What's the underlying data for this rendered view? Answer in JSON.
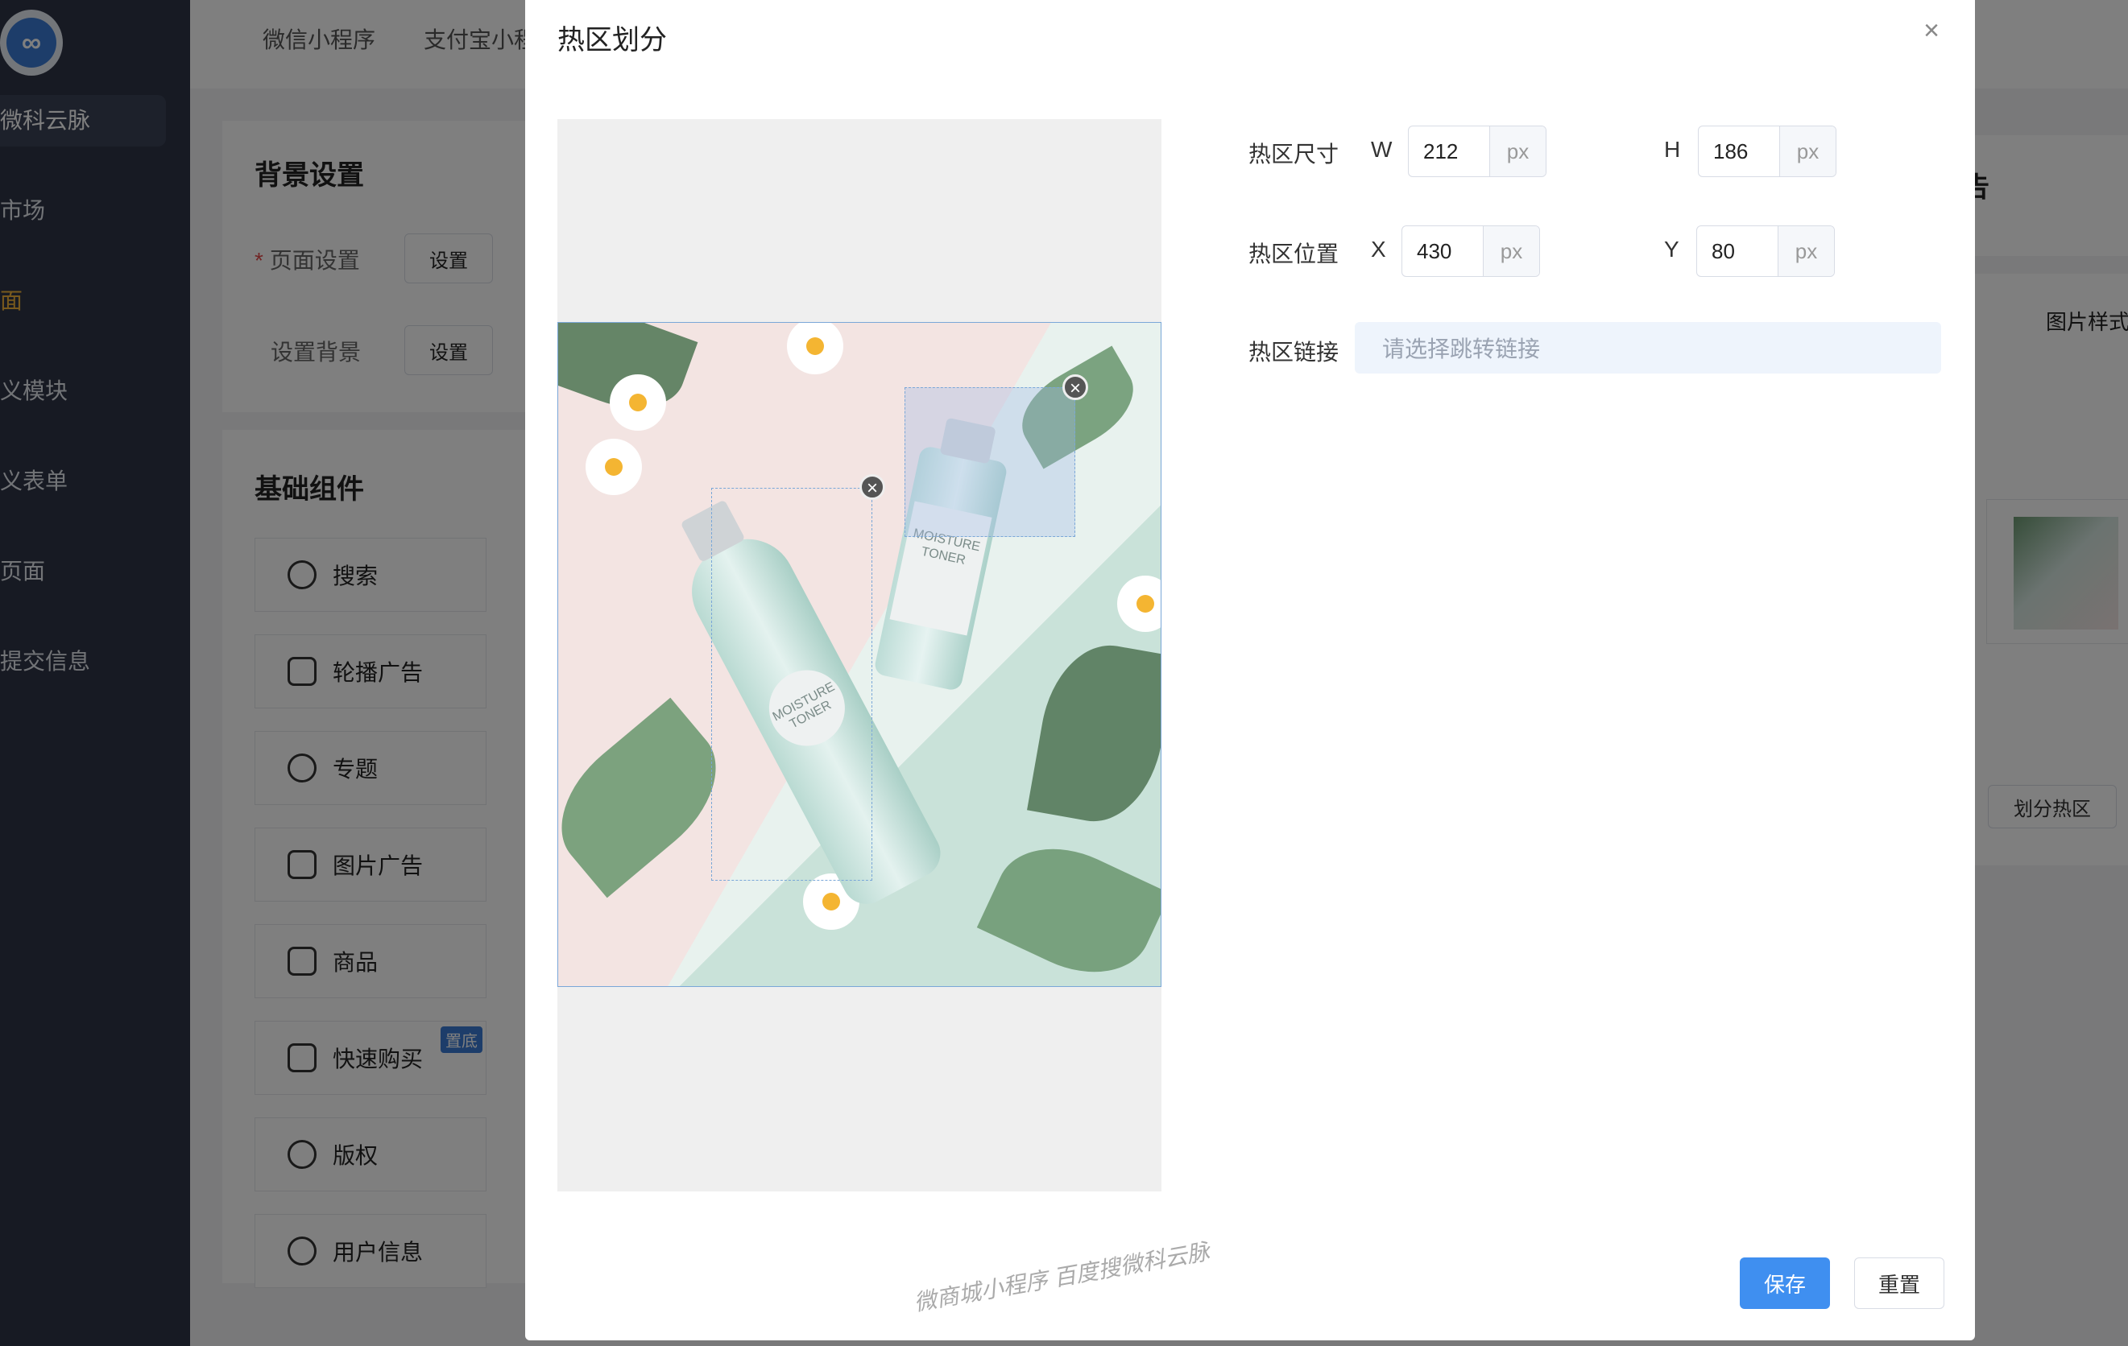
{
  "sidebar": {
    "brand": "微科云脉",
    "items": [
      {
        "label": "市场"
      },
      {
        "label": "面"
      },
      {
        "label": "义模块"
      },
      {
        "label": "义表单"
      },
      {
        "label": "页面"
      },
      {
        "label": "提交信息"
      }
    ]
  },
  "topbar": {
    "tabs": [
      "微信小程序",
      "支付宝小程"
    ]
  },
  "background_settings": {
    "title": "背景设置",
    "page_settings_label": "页面设置",
    "page_settings_button": "设置",
    "bg_label": "设置背景",
    "bg_button": "设置"
  },
  "basic_components": {
    "title": "基础组件",
    "items": [
      {
        "label": "搜索",
        "icon": "search-icon"
      },
      {
        "label": "轮播广告",
        "icon": "carousel-icon"
      },
      {
        "label": "专题",
        "icon": "topic-icon"
      },
      {
        "label": "图片广告",
        "icon": "image-icon"
      },
      {
        "label": "商品",
        "icon": "product-icon"
      },
      {
        "label": "快速购买",
        "icon": "cart-icon",
        "badge": "置底"
      },
      {
        "label": "版权",
        "icon": "copyright-icon"
      },
      {
        "label": "用户信息",
        "icon": "user-icon"
      }
    ]
  },
  "right_panel": {
    "title_fragment": "告",
    "tab": "图片样式",
    "hotzone_button": "划分热区"
  },
  "modal": {
    "title": "热区划分",
    "close_icon": "close-icon",
    "size_label": "热区尺寸",
    "width_axis": "W",
    "width_value": "212",
    "height_axis": "H",
    "height_value": "186",
    "position_label": "热区位置",
    "x_axis": "X",
    "x_value": "430",
    "y_axis": "Y",
    "y_value": "80",
    "unit": "px",
    "link_label": "热区链接",
    "link_placeholder": "请选择跳转链接",
    "save": "保存",
    "reset": "重置",
    "watermark": "微商城小程序 百度搜微科云脉"
  }
}
